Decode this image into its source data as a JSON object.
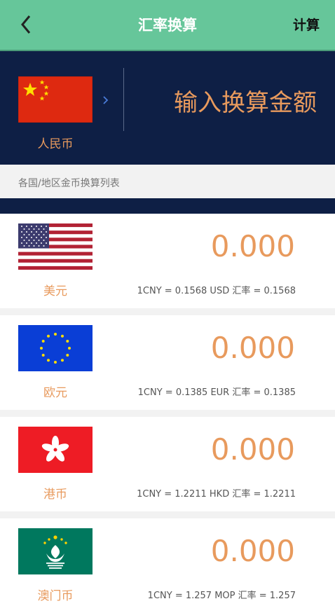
{
  "header": {
    "title": "汇率换算",
    "calc_label": "计算"
  },
  "base": {
    "name": "人民币",
    "input_placeholder": "输入换算金额"
  },
  "list_title": "各国/地区金币换算列表",
  "currencies": [
    {
      "name": "美元",
      "value": "0.000",
      "rate_text": "1CNY = 0.1568 USD 汇率 = 0.1568"
    },
    {
      "name": "欧元",
      "value": "0.000",
      "rate_text": "1CNY = 0.1385 EUR 汇率 = 0.1385"
    },
    {
      "name": "港币",
      "value": "0.000",
      "rate_text": "1CNY = 1.2211 HKD 汇率 = 1.2211"
    },
    {
      "name": "澳门币",
      "value": "0.000",
      "rate_text": "1CNY = 1.257 MOP 汇率 = 1.257"
    }
  ],
  "colors": {
    "header": "#66c69a",
    "navy": "#0e1f45",
    "accent": "#e89a5d"
  },
  "icons": [
    "back-chevron-icon",
    "chevron-right-icon",
    "china-flag-icon",
    "usa-flag-icon",
    "eu-flag-icon",
    "hk-flag-icon",
    "macau-flag-icon"
  ]
}
